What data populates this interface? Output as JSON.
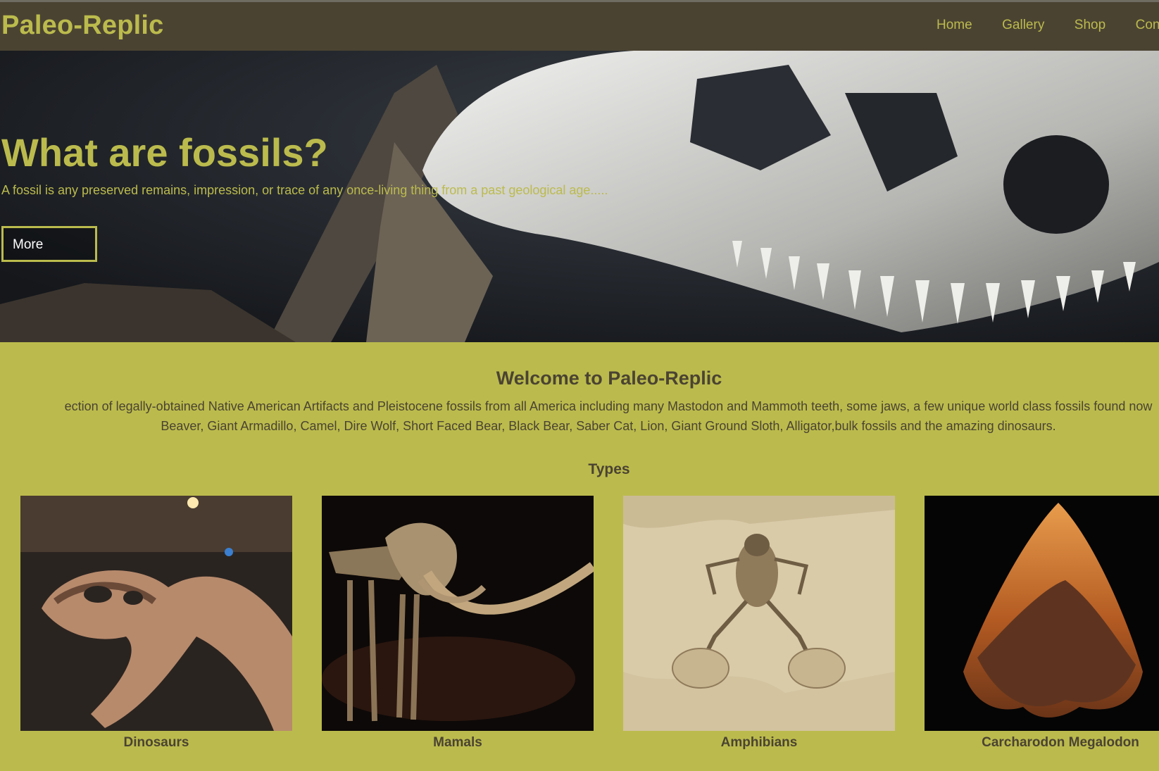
{
  "header": {
    "logo": "Paleo-Replic",
    "nav": [
      "Home",
      "Gallery",
      "Shop",
      "Con"
    ]
  },
  "hero": {
    "title": "What are fossils?",
    "subtitle": "A fossil is any preserved remains, impression, or trace of any once-living thing from a past geological age.....",
    "button": "More"
  },
  "welcome": {
    "title": "Welcome to Paleo-Replic",
    "line1": "ection of legally-obtained Native American Artifacts and Pleistocene fossils from all America including many Mastodon and Mammoth teeth, some jaws, a few unique world class fossils found now",
    "line2": "Beaver, Giant Armadillo, Camel, Dire Wolf, Short Faced Bear, Black Bear, Saber Cat, Lion, Giant Ground Sloth, Alligator,bulk fossils and the amazing dinosaurs."
  },
  "types": {
    "title": "Types",
    "items": [
      {
        "label": "Dinosaurs"
      },
      {
        "label": "Mamals"
      },
      {
        "label": "Amphibians"
      },
      {
        "label": "Carcharodon Megalodon"
      }
    ]
  },
  "colors": {
    "header_bg": "#4b4332",
    "accent": "#bbbb4d",
    "text_dark": "#4b4332"
  }
}
